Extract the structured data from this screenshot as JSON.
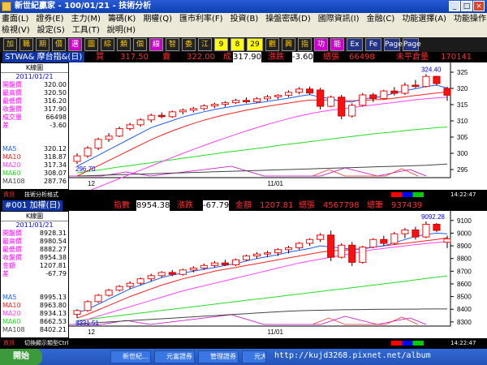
{
  "window": {
    "title": "新世紀贏家 - 100/01/21 - 技術分析"
  },
  "menu": {
    "row1": [
      "畫面(L)",
      "證券(E)",
      "主力(M)",
      "籌碼(K)",
      "期權(Q)",
      "匯市利率(F)",
      "投資(B)",
      "操盤密碼(D)",
      "國際資訊(I)",
      "金融(C)",
      "功能選擇(A)",
      "功能操作(R)"
    ],
    "row2": [
      "檢視(V)",
      "設定(S)",
      "工具(T)",
      "說明(H)"
    ]
  },
  "toolbar": {
    "buttons": [
      "加",
      "職",
      "期",
      "價",
      "選",
      "圖",
      "綜",
      "類",
      "個",
      "線",
      "智",
      "委",
      "江",
      "9",
      "8",
      "29",
      "觀",
      "興",
      "指",
      "功",
      "能",
      "Ex",
      "Fe",
      "Page",
      "Page"
    ]
  },
  "panel1": {
    "symbol": "STWA& 摩台指&(日)",
    "buy_label": "買",
    "buy": "317.50",
    "sell_label": "賣",
    "sell": "322.00",
    "deal_label": "成",
    "deal": "317.90",
    "change_label": "漲跌",
    "change": "-3.60",
    "volume_label": "總張",
    "volume": "66498",
    "oi_label": "未平倉量",
    "oi": "170141",
    "side": {
      "title": "K線圖",
      "date": "2011/01/21",
      "rows": [
        {
          "label": "開盤價",
          "value": "320.00"
        },
        {
          "label": "最高價",
          "value": "320.50"
        },
        {
          "label": "最低價",
          "value": "316.20"
        },
        {
          "label": "收盤價",
          "value": "317.90"
        },
        {
          "label": "成交量",
          "value": "66498"
        },
        {
          "label": "差",
          "value": "-3.60"
        }
      ],
      "ma": [
        {
          "label": "MA5",
          "value": "320.12"
        },
        {
          "label": "MA10",
          "value": "318.87"
        },
        {
          "label": "MA20",
          "value": "317.34"
        },
        {
          "label": "MA60",
          "value": "308.07"
        },
        {
          "label": "MA108",
          "value": "287.76"
        }
      ]
    },
    "chart_high_label": "324.40",
    "chart_low_label": "296.70",
    "x_labels": [
      "12",
      "11/01"
    ],
    "status_left": "資訊",
    "status_mid": "技術分析格式",
    "status_time": "14:22:47"
  },
  "panel2": {
    "symbol": "#001 加權(日)",
    "index_label": "指數",
    "index": "8954.38",
    "change_label": "漲跌",
    "change": "-67.79",
    "amount_label": "金額",
    "amount": "1207.81",
    "volume_label": "總張",
    "volume": "4567798",
    "count_label": "總筆",
    "count": "937439",
    "side": {
      "title": "K線圖",
      "date": "2011/01/21",
      "rows": [
        {
          "label": "開盤價",
          "value": "8928.31"
        },
        {
          "label": "最高價",
          "value": "8980.54"
        },
        {
          "label": "最低價",
          "value": "8882.27"
        },
        {
          "label": "收盤價",
          "value": "8954.38"
        },
        {
          "label": "金額",
          "value": "1207.81"
        },
        {
          "label": "差",
          "value": "-67.79"
        }
      ],
      "ma": [
        {
          "label": "MA5",
          "value": "8995.13"
        },
        {
          "label": "MA10",
          "value": "8963.80"
        },
        {
          "label": "MA20",
          "value": "8934.13"
        },
        {
          "label": "MA60",
          "value": "8662.53"
        },
        {
          "label": "MA108",
          "value": "8402.21"
        }
      ]
    },
    "chart_high_label": "9092.28",
    "chart_low_label": "8331.51",
    "x_labels": [
      "12",
      "11/01"
    ],
    "status_left": "資訊",
    "status_mid": "切換顯示類型Ctrl",
    "status_time": "14:22:47"
  },
  "taskbar": {
    "start": "開始",
    "items": [
      "新世紀...",
      "元富證券",
      "管理證券",
      "元大..."
    ],
    "watermark": "http://kujd3268.pixnet.net/album"
  },
  "colors": {
    "red": "#ff0000",
    "green": "#00c000",
    "blue": "#0000ff",
    "ma5": "#1e5cff",
    "ma10": "#ff2020",
    "ma20": "#ff40ff",
    "ma60": "#22dd22",
    "ma108": "#444444"
  },
  "chart_data": [
    {
      "type": "candlestick",
      "title": "STWA& 摩台指&(日)",
      "ylim": [
        293,
        327
      ],
      "yticks": [
        295,
        300,
        305,
        310,
        315,
        320,
        325
      ],
      "x_ticks": [
        "12",
        "11/01"
      ],
      "ohlc": [
        [
          297.5,
          300.0,
          296.7,
          299.2
        ],
        [
          299.2,
          302.2,
          298.6,
          301.6
        ],
        [
          301.6,
          304.8,
          301.0,
          304.3
        ],
        [
          304.3,
          306.2,
          303.5,
          305.3
        ],
        [
          305.3,
          308.2,
          305.0,
          307.6
        ],
        [
          307.6,
          309.4,
          307.0,
          308.8
        ],
        [
          308.8,
          310.8,
          308.2,
          310.3
        ],
        [
          310.3,
          312.2,
          309.5,
          311.7
        ],
        [
          311.7,
          312.6,
          310.8,
          311.3
        ],
        [
          311.3,
          313.2,
          310.9,
          312.8
        ],
        [
          312.8,
          313.8,
          312.0,
          313.3
        ],
        [
          313.3,
          314.3,
          312.6,
          313.8
        ],
        [
          313.8,
          315.1,
          313.2,
          314.6
        ],
        [
          314.6,
          315.6,
          313.9,
          315.1
        ],
        [
          315.1,
          316.1,
          314.3,
          315.6
        ],
        [
          315.6,
          316.8,
          315.2,
          316.3
        ],
        [
          316.3,
          317.2,
          315.4,
          315.9
        ],
        [
          315.9,
          317.3,
          315.5,
          316.8
        ],
        [
          316.8,
          318.0,
          316.2,
          317.4
        ],
        [
          317.4,
          318.2,
          316.7,
          317.9
        ],
        [
          317.9,
          319.4,
          317.3,
          318.8
        ],
        [
          318.8,
          320.4,
          318.2,
          319.8
        ],
        [
          319.8,
          320.6,
          318.0,
          318.6
        ],
        [
          319.5,
          320.2,
          313.5,
          314.5
        ],
        [
          314.5,
          317.8,
          314.2,
          317.3
        ],
        [
          317.3,
          318.0,
          310.5,
          311.5
        ],
        [
          311.5,
          315.4,
          311.0,
          314.8
        ],
        [
          314.8,
          318.6,
          314.4,
          318.0
        ],
        [
          318.0,
          318.6,
          315.8,
          316.9
        ],
        [
          316.9,
          319.6,
          316.6,
          319.2
        ],
        [
          319.2,
          320.4,
          317.8,
          318.5
        ],
        [
          318.5,
          321.8,
          318.0,
          321.0
        ],
        [
          321.0,
          322.6,
          320.1,
          320.6
        ],
        [
          320.6,
          324.4,
          320.3,
          323.7
        ],
        [
          323.7,
          323.9,
          321.0,
          321.5
        ],
        [
          320.0,
          320.5,
          316.2,
          317.9
        ]
      ],
      "ma": {
        "MA5": [
          296.0,
          297.7,
          299.4,
          301.1,
          302.8,
          304.5,
          306.2,
          307.9,
          309.0,
          310.1,
          311.2,
          312.0,
          312.8,
          313.5,
          314.1,
          314.6,
          315.1,
          315.5,
          316.0,
          316.5,
          317.0,
          317.6,
          318.1,
          317.3,
          316.8,
          316.0,
          315.8,
          316.8,
          317.1,
          317.6,
          318.6,
          319.3,
          319.9,
          320.6,
          321.0,
          320.1
        ],
        "MA10": [
          293.0,
          294.6,
          296.2,
          297.8,
          299.4,
          301.0,
          302.6,
          304.2,
          305.6,
          306.9,
          308.1,
          309.2,
          310.2,
          311.1,
          311.9,
          312.6,
          313.3,
          313.9,
          314.5,
          315.0,
          315.5,
          316.0,
          316.4,
          316.4,
          316.4,
          316.3,
          316.2,
          316.3,
          316.5,
          316.6,
          317.0,
          317.4,
          317.8,
          318.2,
          318.6,
          318.9
        ],
        "MA20": [
          287.0,
          288.3,
          289.6,
          290.9,
          292.2,
          293.5,
          294.8,
          296.1,
          297.4,
          298.7,
          300.0,
          301.2,
          302.4,
          303.6,
          304.7,
          305.8,
          306.9,
          307.9,
          308.9,
          309.8,
          310.7,
          311.5,
          312.2,
          312.8,
          313.3,
          313.7,
          314.1,
          314.5,
          314.9,
          315.3,
          315.7,
          316.1,
          316.5,
          316.8,
          317.1,
          317.3
        ],
        "MA60": [
          294.0,
          294.4,
          294.8,
          295.3,
          295.8,
          296.2,
          296.7,
          297.1,
          297.6,
          298.0,
          298.5,
          298.9,
          299.4,
          299.8,
          300.3,
          300.7,
          301.1,
          301.5,
          301.9,
          302.4,
          302.8,
          303.2,
          303.6,
          304.0,
          304.4,
          304.8,
          305.2,
          305.6,
          306.0,
          306.3,
          306.6,
          307.0,
          307.3,
          307.6,
          307.9,
          308.1
        ],
        "MA108": [
          293.0,
          293.1,
          293.2,
          293.3,
          293.4,
          293.5,
          293.6,
          293.7,
          293.8,
          293.9,
          294.0,
          294.1,
          294.2,
          294.3,
          294.4,
          294.5,
          294.6,
          294.7,
          294.8,
          294.9,
          295.0,
          295.1,
          295.2,
          295.3,
          295.4,
          295.5,
          295.6,
          295.7,
          295.8,
          295.9,
          296.0,
          296.1,
          296.2,
          296.3,
          296.5,
          296.7
        ]
      }
    },
    {
      "type": "candlestick",
      "title": "#001 加權(日)",
      "ylim": [
        8280,
        9150
      ],
      "yticks": [
        8300,
        8400,
        8500,
        8600,
        8700,
        8800,
        8900,
        9000,
        9100
      ],
      "x_ticks": [
        "12",
        "11/01"
      ],
      "ohlc": [
        [
          8360,
          8400,
          8331.51,
          8390
        ],
        [
          8390,
          8470,
          8380,
          8460
        ],
        [
          8460,
          8520,
          8450,
          8510
        ],
        [
          8510,
          8560,
          8500,
          8550
        ],
        [
          8550,
          8590,
          8540,
          8580
        ],
        [
          8580,
          8620,
          8560,
          8605
        ],
        [
          8605,
          8650,
          8590,
          8640
        ],
        [
          8640,
          8680,
          8620,
          8665
        ],
        [
          8665,
          8700,
          8650,
          8690
        ],
        [
          8690,
          8710,
          8660,
          8675
        ],
        [
          8675,
          8720,
          8665,
          8710
        ],
        [
          8710,
          8740,
          8690,
          8725
        ],
        [
          8725,
          8760,
          8710,
          8745
        ],
        [
          8745,
          8780,
          8730,
          8765
        ],
        [
          8765,
          8790,
          8740,
          8750
        ],
        [
          8750,
          8800,
          8740,
          8790
        ],
        [
          8790,
          8830,
          8780,
          8820
        ],
        [
          8820,
          8850,
          8800,
          8835
        ],
        [
          8835,
          8860,
          8810,
          8845
        ],
        [
          8845,
          8880,
          8820,
          8870
        ],
        [
          8870,
          8900,
          8840,
          8885
        ],
        [
          8885,
          8930,
          8870,
          8920
        ],
        [
          8920,
          8960,
          8900,
          8950
        ],
        [
          8950,
          9000,
          8930,
          8985
        ],
        [
          8985,
          9020,
          8780,
          8810
        ],
        [
          8810,
          8920,
          8800,
          8905
        ],
        [
          8905,
          8930,
          8740,
          8770
        ],
        [
          8770,
          8900,
          8760,
          8890
        ],
        [
          8890,
          8960,
          8880,
          8950
        ],
        [
          8950,
          8980,
          8900,
          8920
        ],
        [
          8920,
          9010,
          8910,
          8995
        ],
        [
          8995,
          9040,
          8960,
          9025
        ],
        [
          9025,
          9050,
          8950,
          8970
        ],
        [
          8970,
          9092.28,
          8960,
          9070
        ],
        [
          9070,
          9080,
          9010,
          9022
        ],
        [
          8928.31,
          8980.54,
          8882.27,
          8954.38
        ]
      ],
      "ma": {
        "MA5": [
          8370,
          8400,
          8440,
          8480,
          8520,
          8560,
          8590,
          8620,
          8650,
          8670,
          8685,
          8700,
          8715,
          8730,
          8745,
          8760,
          8780,
          8800,
          8815,
          8830,
          8850,
          8865,
          8880,
          8900,
          8890,
          8885,
          8870,
          8875,
          8890,
          8900,
          8925,
          8950,
          8975,
          8990,
          9000,
          8995
        ],
        "MA10": [
          8330,
          8360,
          8395,
          8430,
          8465,
          8500,
          8530,
          8560,
          8590,
          8615,
          8640,
          8660,
          8680,
          8700,
          8715,
          8730,
          8745,
          8760,
          8775,
          8790,
          8805,
          8820,
          8835,
          8850,
          8860,
          8865,
          8870,
          8880,
          8890,
          8900,
          8910,
          8920,
          8930,
          8940,
          8950,
          8964
        ],
        "MA20": [
          8300,
          8320,
          8345,
          8370,
          8395,
          8420,
          8445,
          8470,
          8495,
          8520,
          8545,
          8565,
          8585,
          8605,
          8625,
          8645,
          8665,
          8685,
          8705,
          8725,
          8745,
          8765,
          8780,
          8795,
          8810,
          8825,
          8840,
          8855,
          8870,
          8880,
          8890,
          8900,
          8910,
          8918,
          8926,
          8934
        ],
        "MA60": [
          8310,
          8320,
          8330,
          8340,
          8350,
          8360,
          8370,
          8380,
          8390,
          8400,
          8410,
          8420,
          8430,
          8440,
          8450,
          8460,
          8470,
          8480,
          8490,
          8500,
          8510,
          8520,
          8530,
          8540,
          8550,
          8560,
          8570,
          8580,
          8590,
          8600,
          8610,
          8620,
          8632,
          8643,
          8653,
          8662
        ],
        "MA108": [
          8285,
          8290,
          8295,
          8300,
          8305,
          8310,
          8315,
          8320,
          8325,
          8330,
          8335,
          8340,
          8345,
          8350,
          8355,
          8360,
          8365,
          8370,
          8375,
          8380,
          8385,
          8388,
          8390,
          8392,
          8394,
          8396,
          8397,
          8398,
          8399,
          8400,
          8400,
          8401,
          8401,
          8402,
          8402,
          8402
        ]
      }
    }
  ]
}
